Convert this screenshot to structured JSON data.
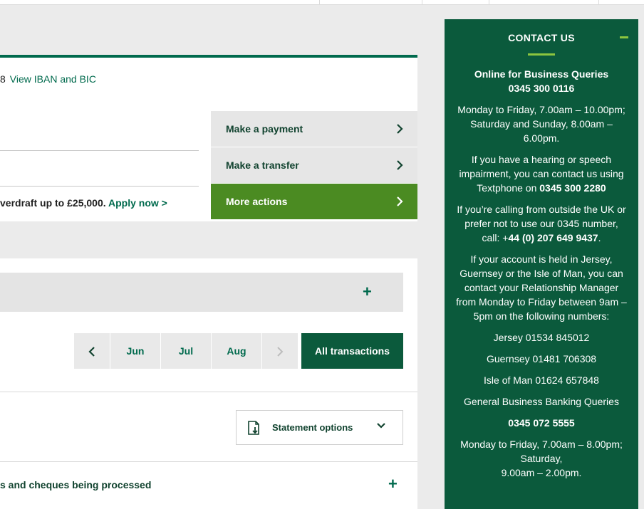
{
  "account": {
    "iban_prefix": "8",
    "iban_link": "View IBAN and BIC",
    "promo_text": "verdraft up to £25,000.",
    "promo_link": "Apply now >"
  },
  "actions": [
    {
      "label": "Make a payment"
    },
    {
      "label": "Make a transfer"
    },
    {
      "label": "More actions"
    }
  ],
  "months": {
    "prev": "‹",
    "items": [
      "Jun",
      "Jul",
      "Aug"
    ],
    "next": "›",
    "all": "All transactions"
  },
  "statement": {
    "label": "Statement options"
  },
  "processing": {
    "label": "s and cheques being processed"
  },
  "contact": {
    "title": "CONTACT US",
    "online_heading": "Online for Business Queries",
    "online_number": "0345 300 0116",
    "hours_weekday": "Monday to Friday, 7.00am – 10.00pm;",
    "hours_weekend": "Saturday and Sunday, 8.00am – 6.00pm.",
    "hearing_text": "If you have a hearing or speech impairment, you can contact us using Textphone on",
    "hearing_number": "0345 300 2280",
    "outside_text": "If you’re calling from outside the UK or prefer not to use our 0345 number, call: +",
    "outside_number": "44 (0) 207 649 9437",
    "islands_text": "If your account is held in Jersey, Guernsey or the Isle of Man, you can contact your Relationship Manager from Monday to Friday between 9am – 5pm on the following numbers:",
    "jersey": "Jersey 01534 845012",
    "guernsey": "Guernsey 01481 706308",
    "isle_of_man": "Isle of Man 01624 657848",
    "general_heading": "General Business Banking Queries",
    "general_number": "0345 072 5555",
    "general_weekday": "Monday to Friday, 7.00am – 8.00pm;",
    "general_saturday": "Saturday,",
    "general_saturday_hours": "9.00am – 2.00pm."
  },
  "colors": {
    "brand_green": "#006a4d",
    "dark_green": "#0b5a3c",
    "action_green": "#4b8b22",
    "accent_lime": "#8dc63f"
  },
  "icons": {
    "chevron": "chevron-right-icon",
    "plus": "plus-icon",
    "minus": "minus-icon",
    "statement": "document-download-icon",
    "dropdown": "chevron-down-icon"
  }
}
